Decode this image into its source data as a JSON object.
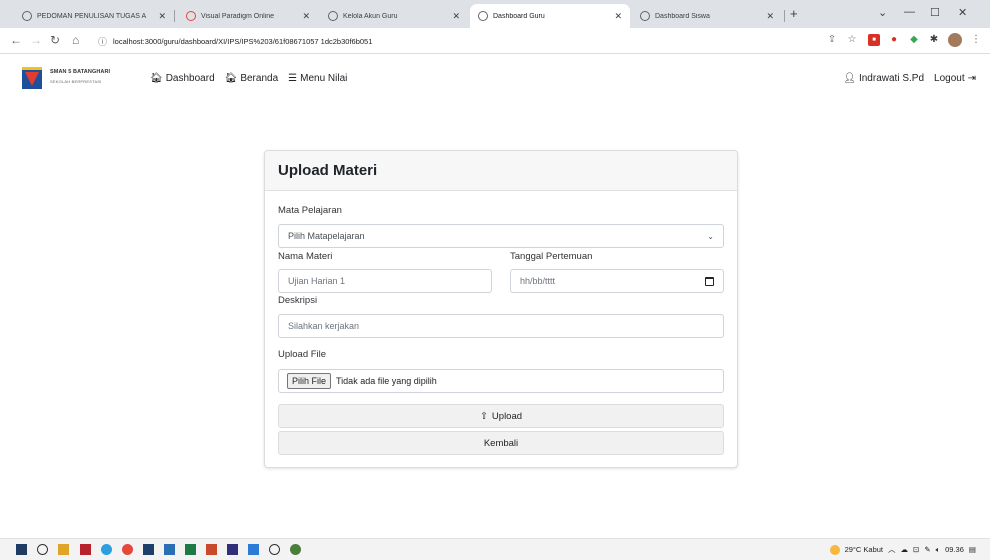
{
  "browser": {
    "tabs": [
      {
        "title": "PEDOMAN PENULISAN TUGAS A",
        "active": false
      },
      {
        "title": "Visual Paradigm Online",
        "active": false
      },
      {
        "title": "Kelola Akun Guru",
        "active": false
      },
      {
        "title": "Dashboard Guru",
        "active": true
      },
      {
        "title": "Dashboard Siswa",
        "active": false
      }
    ],
    "url": "localhost:3000/guru/dashboard/XI/IPS/IPS%203/61f08671057 1dc2b30f6b051"
  },
  "nav": {
    "school_name": "SMAN 5 BATANGHARI",
    "school_slogan": "SEKOLAH BERPRESTASI",
    "links": [
      "Dashboard",
      "Beranda",
      "Menu Nilai"
    ],
    "user": "Indrawati S.Pd",
    "logout": "Logout"
  },
  "form": {
    "title": "Upload Materi",
    "subject_label": "Mata Pelajaran",
    "subject_value": "Pilih Matapelajaran",
    "material_label": "Nama Materi",
    "material_placeholder": "Ujian Harian 1",
    "date_label": "Tanggal Pertemuan",
    "date_placeholder": "hh/bb/tttt",
    "desc_label": "Deskripsi",
    "desc_placeholder": "Silahkan kerjakan",
    "file_label": "Upload File",
    "file_button": "Pilih File",
    "file_status": "Tidak ada file yang dipilih",
    "upload_button": "Upload",
    "back_button": "Kembali"
  },
  "taskbar": {
    "weather": "29°C Kabut",
    "time": "09.36"
  },
  "colors": {
    "logo_blue": "#1f4e9a",
    "logo_red": "#e03c31",
    "card_header": "#f7f7f7",
    "tab_strip": "#dee1e6"
  }
}
